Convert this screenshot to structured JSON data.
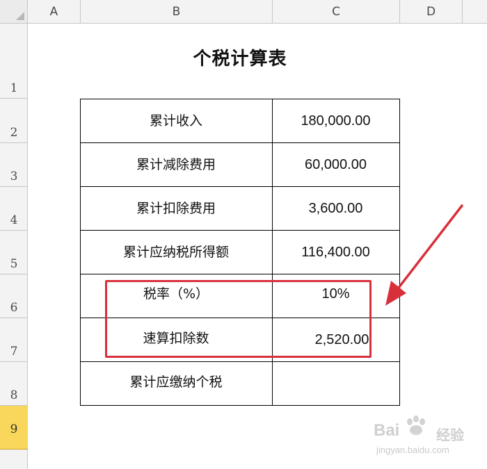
{
  "spreadsheet": {
    "column_headers": [
      "A",
      "B",
      "C",
      "D"
    ],
    "row_headers": [
      "1",
      "2",
      "3",
      "4",
      "5",
      "6",
      "7",
      "8",
      "9"
    ],
    "selected_row": "9"
  },
  "sheet": {
    "title": "个税计算表",
    "rows": [
      {
        "label": "累计收入",
        "value": "180,000.00"
      },
      {
        "label": "累计减除费用",
        "value": "60,000.00"
      },
      {
        "label": "累计扣除费用",
        "value": "3,600.00"
      },
      {
        "label": "累计应纳税所得额",
        "value": "116,400.00"
      },
      {
        "label": "税率（%）",
        "value": "10%"
      },
      {
        "label": "速算扣除数",
        "value": "2,520.00"
      },
      {
        "label": "累计应缴纳个税",
        "value": ""
      }
    ]
  },
  "annotation": {
    "highlight_color": "#d8303b",
    "arrow_color": "#d8303b"
  },
  "watermark": {
    "brand": "Bai",
    "brand_cn": "经验",
    "url": "jingyan.baidu.com"
  }
}
